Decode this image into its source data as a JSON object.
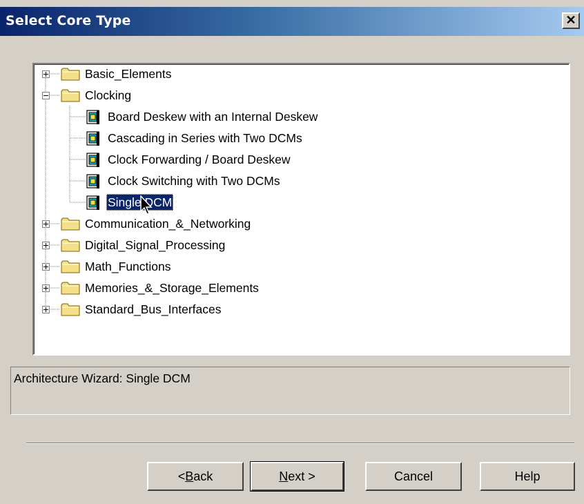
{
  "window": {
    "title": "Select Core Type",
    "close_glyph": "✕"
  },
  "tree": {
    "items": [
      {
        "label": "Basic_Elements",
        "type": "folder",
        "expanded": false
      },
      {
        "label": "Clocking",
        "type": "folder",
        "expanded": true,
        "children": [
          {
            "label": "Board Deskew with an Internal Deskew"
          },
          {
            "label": "Cascading in Series with Two DCMs"
          },
          {
            "label": "Clock Forwarding / Board Deskew"
          },
          {
            "label": "Clock Switching with Two DCMs"
          },
          {
            "label": "Single DCM",
            "selected": true
          }
        ]
      },
      {
        "label": "Communication_&_Networking",
        "type": "folder",
        "expanded": false
      },
      {
        "label": "Digital_Signal_Processing",
        "type": "folder",
        "expanded": false
      },
      {
        "label": "Math_Functions",
        "type": "folder",
        "expanded": false
      },
      {
        "label": "Memories_&_Storage_Elements",
        "type": "folder",
        "expanded": false
      },
      {
        "label": "Standard_Bus_Interfaces",
        "type": "folder",
        "expanded": false
      }
    ]
  },
  "description": "Architecture Wizard: Single DCM",
  "buttons": {
    "back": {
      "prefix": "< ",
      "mnemonic": "B",
      "rest": "ack"
    },
    "next": {
      "mnemonic": "N",
      "rest": "ext >"
    },
    "cancel": "Cancel",
    "help": "Help"
  },
  "colors": {
    "title_gradient_start": "#0a246a",
    "selection": "#0a246a",
    "folder": "#f4e08a"
  }
}
